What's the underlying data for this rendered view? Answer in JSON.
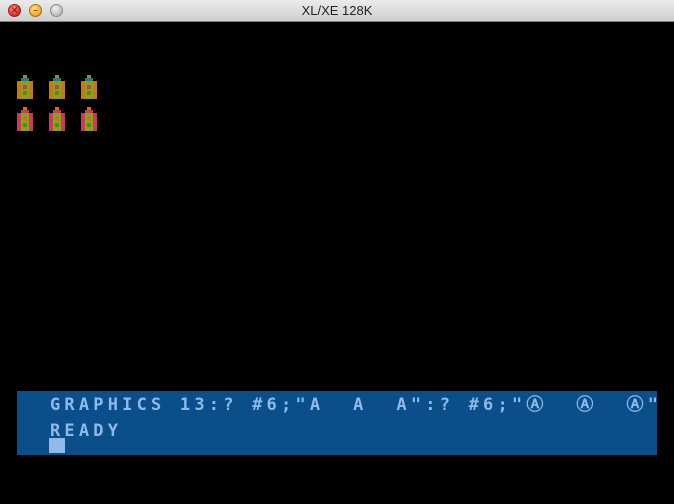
{
  "window": {
    "title": "XL/XE 128K"
  },
  "screen": {
    "command_line": "GRAPHICS 13:? #6;\"A  A  A\":? #6;\"Ⓐ  Ⓐ  Ⓐ\"",
    "status_line": "READY",
    "sprite_count": 6
  },
  "colors": {
    "background": "#000000",
    "text_window_bg": "#0b4f8a",
    "text_color": "#8fb9e8",
    "sprite_colors": [
      "#c07a1a",
      "#8e9e22",
      "#5a8a18",
      "#c0405a",
      "#2a7a7a"
    ]
  },
  "icons": [
    "close-button-icon",
    "minimize-button-icon",
    "zoom-button-icon"
  ]
}
